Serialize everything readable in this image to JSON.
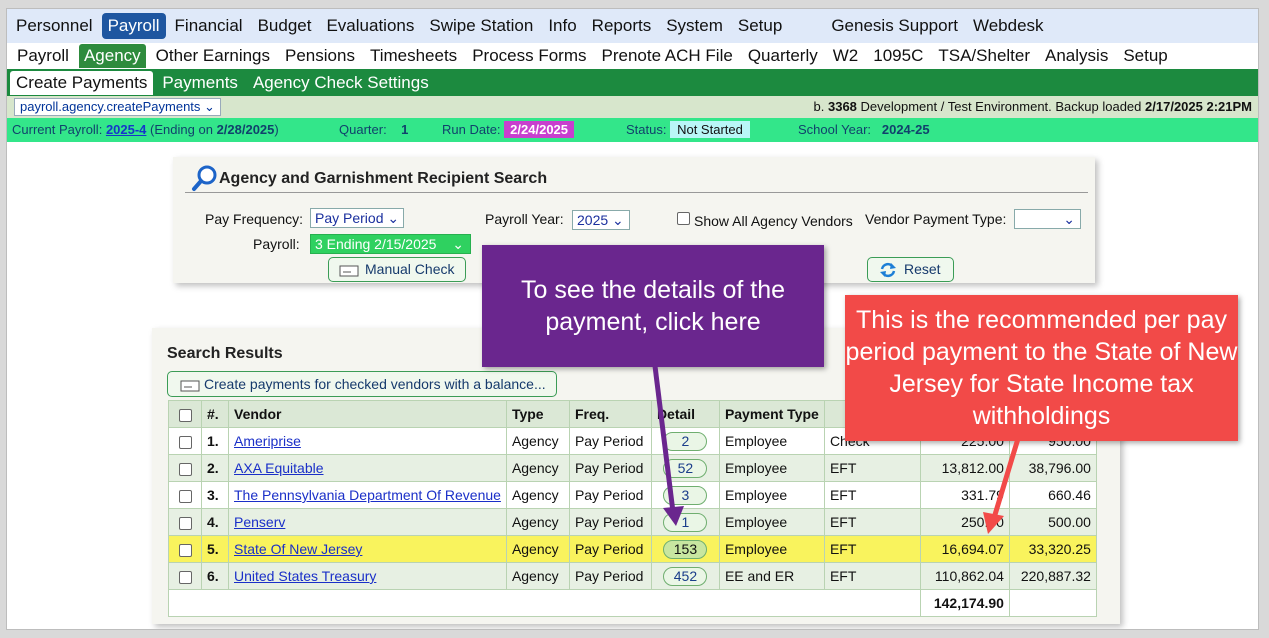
{
  "nav_main": [
    "Personnel",
    "Payroll",
    "Financial",
    "Budget",
    "Evaluations",
    "Swipe Station",
    "Info",
    "Reports",
    "System",
    "Setup"
  ],
  "nav_main_active": "Payroll",
  "nav_main_right": [
    "Genesis Support",
    "Webdesk"
  ],
  "nav_sub": [
    "Payroll",
    "Agency",
    "Other Earnings",
    "Pensions",
    "Timesheets",
    "Process Forms",
    "Prenote ACH File",
    "Quarterly",
    "W2",
    "1095C",
    "TSA/Shelter",
    "Analysis",
    "Setup"
  ],
  "nav_sub_active": "Agency",
  "nav_tabs": [
    "Create Payments",
    "Payments",
    "Agency Check Settings"
  ],
  "nav_tabs_active": "Create Payments",
  "infobar": {
    "page_select": "payroll.agency.createPayments",
    "build_prefix": "b.",
    "build_number": "3368",
    "build_text": "Development / Test Environment. Backup loaded",
    "build_date": "2/17/2025 2:21PM"
  },
  "status": {
    "payroll_label": "Current Payroll:",
    "payroll_value": "2025-4",
    "ending_prefix": "(Ending on",
    "ending_date": "2/28/2025",
    "ending_suffix": ")",
    "quarter_label": "Quarter:",
    "quarter_value": "1",
    "run_date_label": "Run Date:",
    "run_date_value": "2/24/2025",
    "status_label": "Status:",
    "status_value": "Not Started",
    "school_year_label": "School Year:",
    "school_year_value": "2024-25"
  },
  "search": {
    "title": "Agency and Garnishment Recipient Search",
    "pay_frequency_label": "Pay Frequency:",
    "pay_frequency_value": "Pay Period",
    "payroll_year_label": "Payroll Year:",
    "payroll_year_value": "2025",
    "show_all_label": "Show All Agency Vendors",
    "vendor_payment_type_label": "Vendor Payment Type:",
    "vendor_payment_type_value": "",
    "payroll_label": "Payroll:",
    "payroll_value": "3 Ending 2/15/2025",
    "manual_check_label": "Manual Check",
    "reset_label": "Reset"
  },
  "results": {
    "title": "Search Results",
    "create_button": "Create payments for checked vendors with a balance...",
    "columns": [
      "#.",
      "Vendor",
      "Type",
      "Freq.",
      "Detail",
      "Payment Type"
    ],
    "rows": [
      {
        "num": "1.",
        "vendor": "Ameriprise",
        "type": "Agency",
        "freq": "Pay Period",
        "detail": "2",
        "payment_type": "Employee",
        "method": "Check",
        "amount": "225.00",
        "total": "950.00"
      },
      {
        "num": "2.",
        "vendor": "AXA Equitable",
        "type": "Agency",
        "freq": "Pay Period",
        "detail": "52",
        "payment_type": "Employee",
        "method": "EFT",
        "amount": "13,812.00",
        "total": "38,796.00"
      },
      {
        "num": "3.",
        "vendor": "The Pennsylvania Department Of Revenue",
        "type": "Agency",
        "freq": "Pay Period",
        "detail": "3",
        "payment_type": "Employee",
        "method": "EFT",
        "amount": "331.79",
        "total": "660.46"
      },
      {
        "num": "4.",
        "vendor": "Penserv",
        "type": "Agency",
        "freq": "Pay Period",
        "detail": "1",
        "payment_type": "Employee",
        "method": "EFT",
        "amount": "250.00",
        "total": "500.00"
      },
      {
        "num": "5.",
        "vendor": "State Of New Jersey",
        "type": "Agency",
        "freq": "Pay Period",
        "detail": "153",
        "payment_type": "Employee",
        "method": "EFT",
        "amount": "16,694.07",
        "total": "33,320.25"
      },
      {
        "num": "6.",
        "vendor": "United States Treasury",
        "type": "Agency",
        "freq": "Pay Period",
        "detail": "452",
        "payment_type": "EE and ER",
        "method": "EFT",
        "amount": "110,862.04",
        "total": "220,887.32"
      }
    ],
    "grand_total": "142,174.90",
    "highlight_row": 4
  },
  "callouts": {
    "purple": "To see the details of the payment, click here",
    "red": "This is the recommended per pay period payment to the State of New Jersey for State Income tax withholdings"
  },
  "colors": {
    "nav_active": "#1e56a0",
    "tab_bar": "#1c8a3f",
    "status_bar": "#33e68a",
    "row_highlight": "#f9f35d",
    "callout_purple": "#6a268e",
    "callout_red": "#f24a48"
  }
}
